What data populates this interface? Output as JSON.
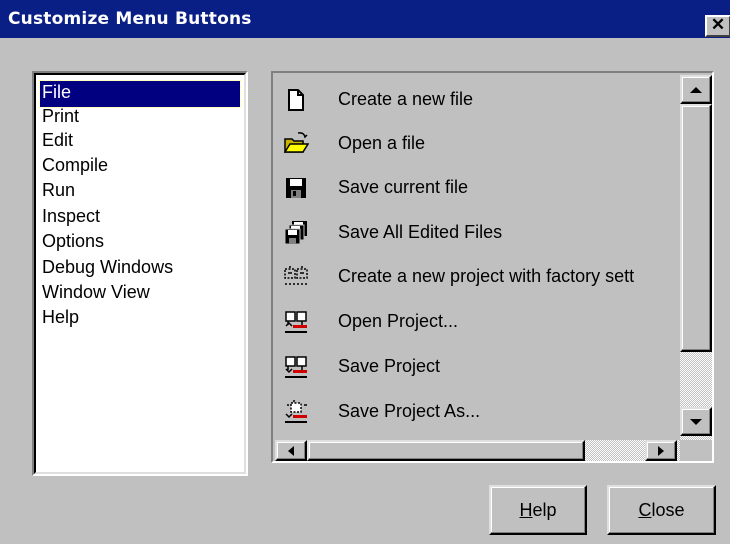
{
  "window": {
    "title": "Customize Menu Buttons",
    "close_glyph": "✕"
  },
  "categories": [
    "File",
    "Print",
    "Edit",
    "Compile",
    "Run",
    "Inspect",
    "Options",
    "Debug Windows",
    "Window View",
    "Help"
  ],
  "selected_category": "File",
  "buttons": [
    {
      "icon": "new-file-icon",
      "label": "Create a new file"
    },
    {
      "icon": "open-folder-icon",
      "label": "Open a file"
    },
    {
      "icon": "floppy-disk-icon",
      "label": "Save current file"
    },
    {
      "icon": "save-all-icon",
      "label": "Save All Edited Files"
    },
    {
      "icon": "new-project-icon",
      "label": "Create a new project with factory sett"
    },
    {
      "icon": "open-project-icon",
      "label": "Open Project..."
    },
    {
      "icon": "save-project-icon",
      "label": "Save Project"
    },
    {
      "icon": "save-project-as-icon",
      "label": "Save Project As..."
    }
  ],
  "footer": {
    "help_first": "H",
    "help_rest": "elp",
    "close_first": "C",
    "close_rest": "lose"
  },
  "colors": {
    "title_bar": "#0a1f86",
    "selection": "#000080",
    "face": "#c0c0c0"
  }
}
